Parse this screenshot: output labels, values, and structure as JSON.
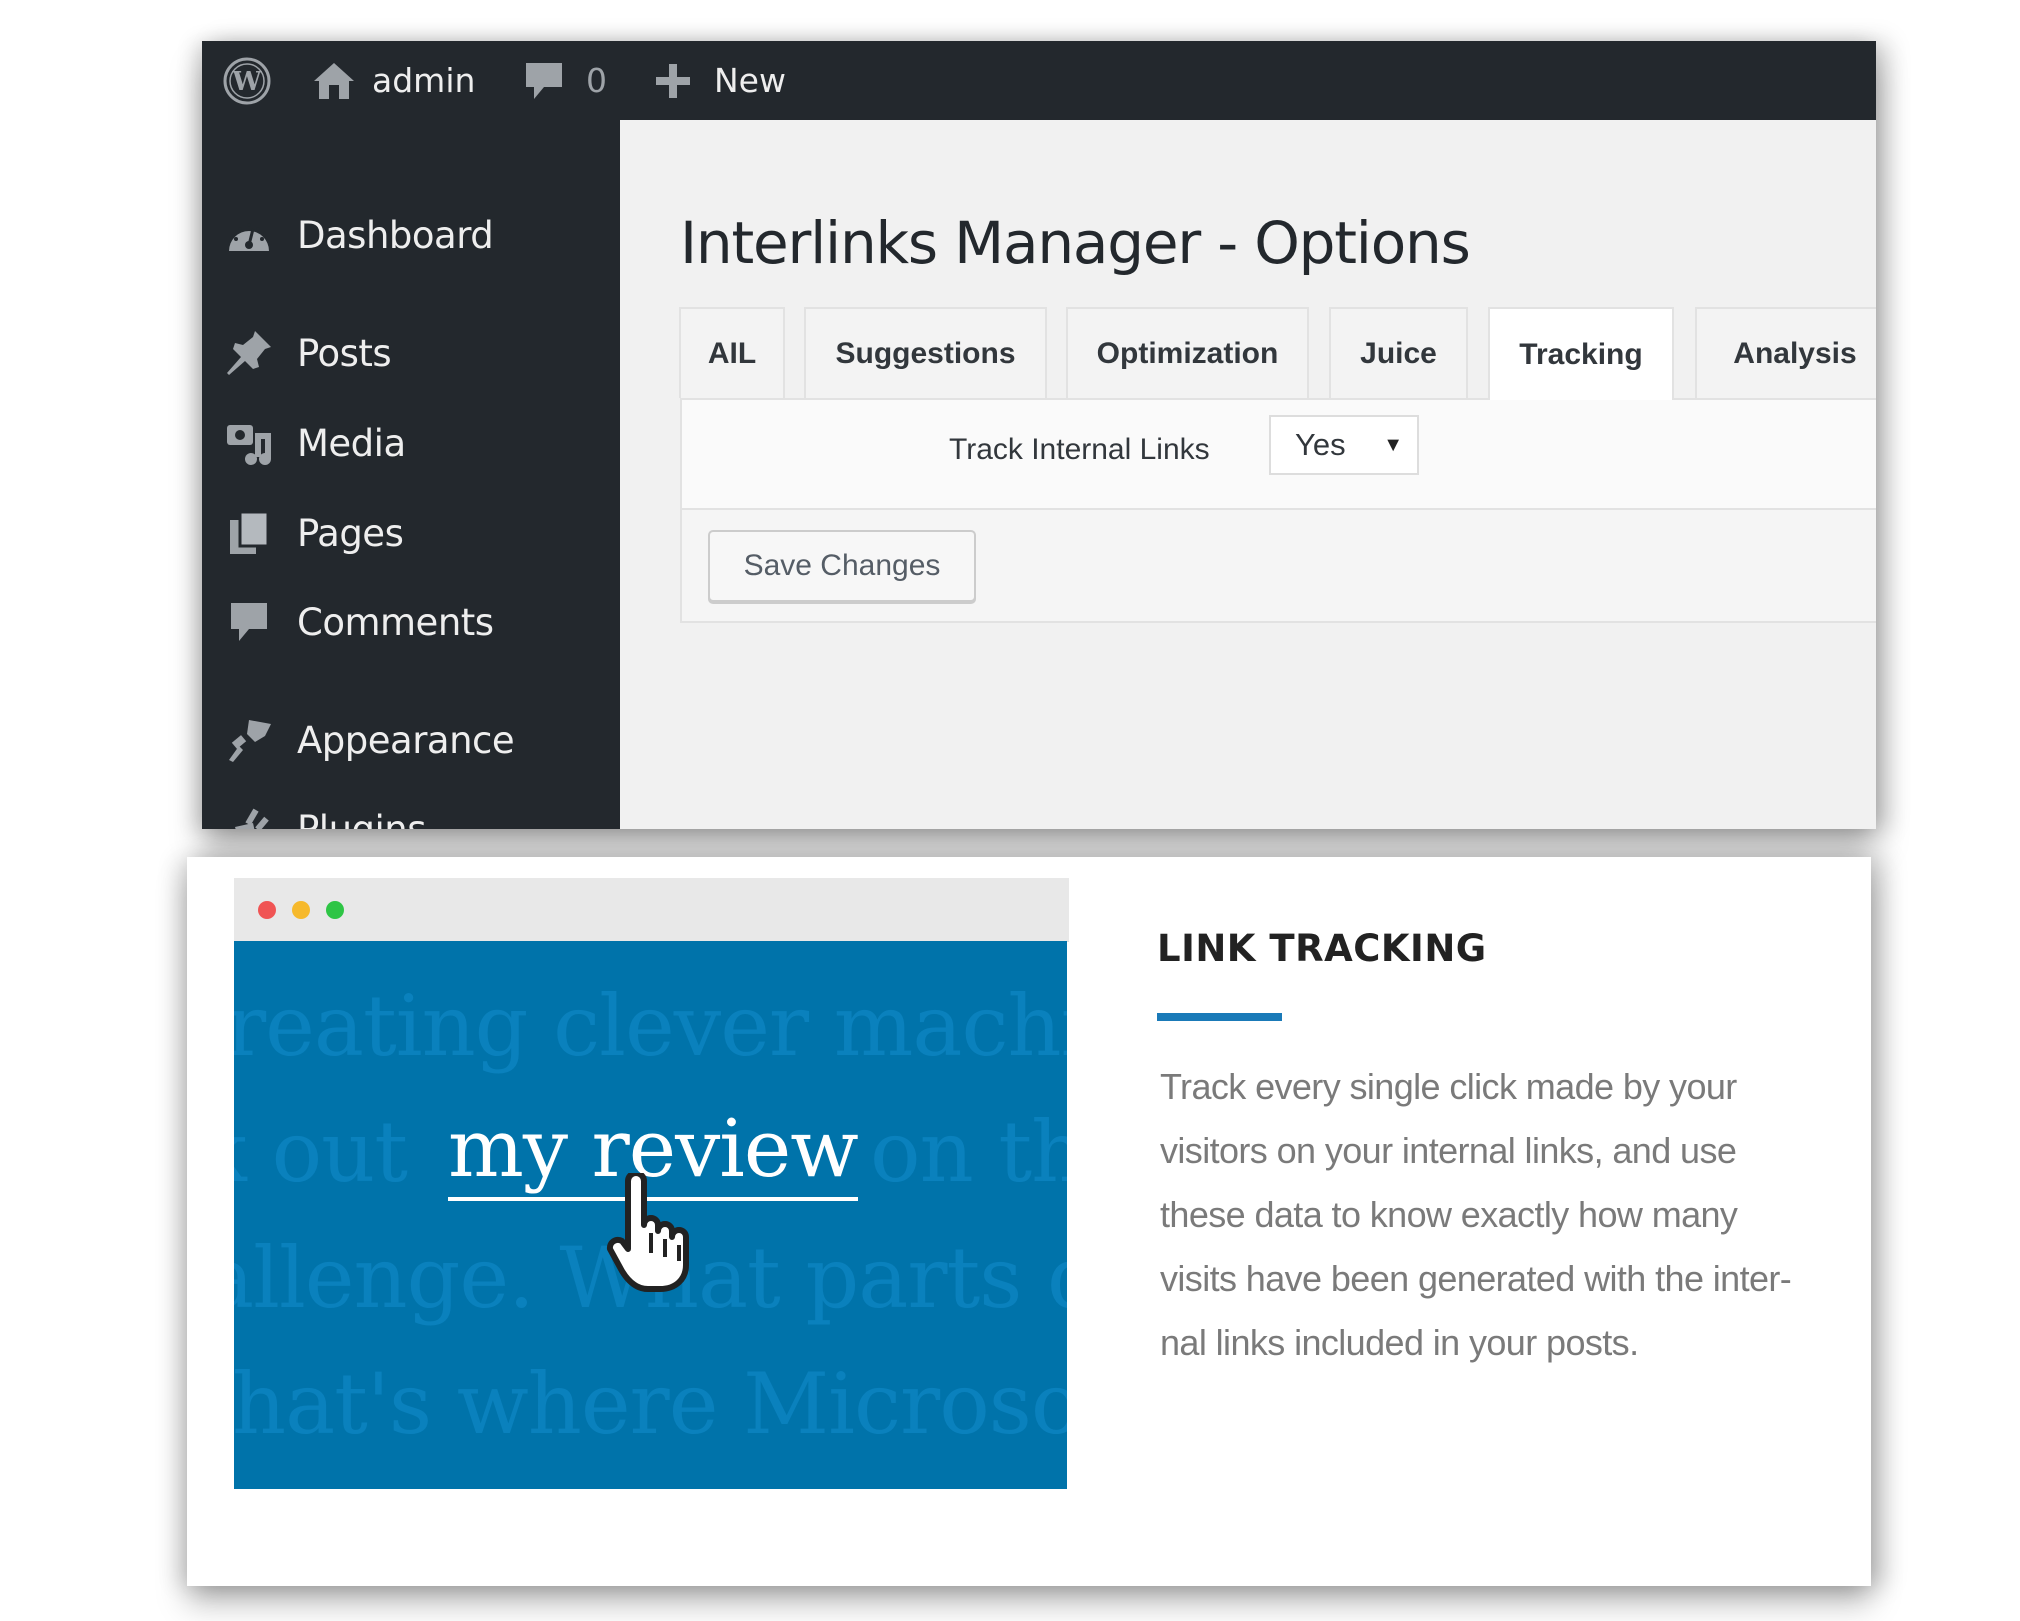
{
  "admin_bar": {
    "logo_icon": "wordpress-logo-icon",
    "site_icon": "home-icon",
    "site_name": "admin",
    "comments_icon": "comment-bubble-icon",
    "comments_count": "0",
    "new_icon": "plus-icon",
    "new_label": "New"
  },
  "sidebar": {
    "items": [
      {
        "label": "Dashboard",
        "icon": "dashboard-gauge-icon"
      },
      {
        "label": "Posts",
        "icon": "pushpin-icon"
      },
      {
        "label": "Media",
        "icon": "media-camera-music-icon"
      },
      {
        "label": "Pages",
        "icon": "pages-icon"
      },
      {
        "label": "Comments",
        "icon": "comment-bubble-icon"
      },
      {
        "label": "Appearance",
        "icon": "paintbrush-icon"
      },
      {
        "label": "Plugins",
        "icon": "plug-icon"
      }
    ]
  },
  "main": {
    "title": "Interlinks Manager - Options",
    "tabs": [
      {
        "label": "AIL",
        "active": false
      },
      {
        "label": "Suggestions",
        "active": false
      },
      {
        "label": "Optimization",
        "active": false
      },
      {
        "label": "Juice",
        "active": false
      },
      {
        "label": "Tracking",
        "active": true
      },
      {
        "label": "Analysis",
        "active": false
      }
    ],
    "fields": [
      {
        "label": "Track Internal Links",
        "value": "Yes",
        "control": "select"
      }
    ],
    "save_label": "Save Changes"
  },
  "feature": {
    "illustration": {
      "window_dots": [
        "#f05454",
        "#f6b92c",
        "#2ec545"
      ],
      "background_lines": [
        "reating clever machin",
        "k out",
        "on th",
        "allenge. What parts d",
        "hat's where Microsoft"
      ],
      "link_text": "my review",
      "cursor_icon": "hand-pointer-icon"
    },
    "title": "LINK TRACKING",
    "body_lines": [
      "Track every single click made by your",
      "visitors on your internal links, and use",
      "these data to know exactly how many",
      "visits have been generated with the inter-",
      "nal links included in your posts."
    ]
  },
  "colors": {
    "admin_dark": "#23282d",
    "wp_blue": "#0073aa",
    "accent": "#1a7ab8",
    "body_text": "#7a7a7a"
  }
}
